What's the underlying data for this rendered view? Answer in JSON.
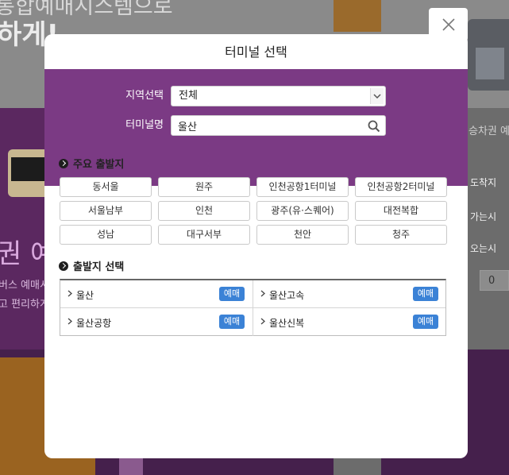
{
  "background": {
    "hero_title": "통합예매시스템으로",
    "hero_title2": "하게!",
    "left_big_text": "권 예",
    "left_small_text1": "버스 예매시",
    "left_small_text2": "고 편리하게",
    "right_header": "승차권 예",
    "right_items": [
      "도착지",
      "가는시",
      "오는시"
    ],
    "right_box_value": "0"
  },
  "modal": {
    "title": "터미널 선택",
    "region_label": "지역선택",
    "region_value": "전체",
    "terminal_label": "터미널명",
    "terminal_value": "울산",
    "major_title": "주요 출발지",
    "major_items": [
      "동서울",
      "원주",
      "인천공항1터미널",
      "인천공항2터미널",
      "서울남부",
      "인천",
      "광주(유·스퀘어)",
      "대전복합",
      "성남",
      "대구서부",
      "천안",
      "청주"
    ],
    "departure_title": "출발지 선택",
    "departures": [
      {
        "name": "울산",
        "badge": "예매"
      },
      {
        "name": "울산고속",
        "badge": "예매"
      },
      {
        "name": "울산공항",
        "badge": "예매"
      },
      {
        "name": "울산신복",
        "badge": "예매"
      }
    ]
  },
  "colors": {
    "header_purple": "#7b3a84",
    "badge_blue": "#3b82d6"
  },
  "icons": [
    "close-icon",
    "chevron-down-icon",
    "search-icon",
    "bullet-arrow-icon",
    "chevron-right-icon"
  ]
}
